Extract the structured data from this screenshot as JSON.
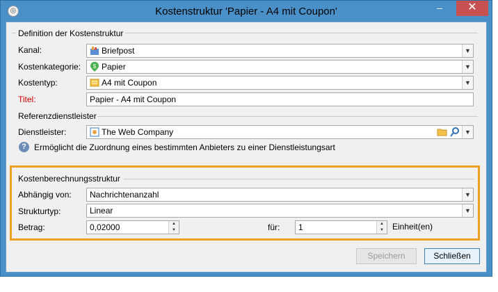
{
  "window": {
    "title": "Kostenstruktur 'Papier - A4 mit Coupon'",
    "controls": {
      "minimize": "–",
      "maximize": "□",
      "close": "✕"
    }
  },
  "definition": {
    "group_title": "Definition der Kostenstruktur",
    "kanal": {
      "label": "Kanal:",
      "value": "Briefpost",
      "icon": "letter-icon"
    },
    "kostenkategorie": {
      "label": "Kostenkategorie:",
      "value": "Papier",
      "icon": "cost-pin-icon"
    },
    "kostentyp": {
      "label": "Kostentyp:",
      "value": "A4 mit Coupon",
      "icon": "document-icon"
    },
    "titel": {
      "label": "Titel:",
      "value": "Papier - A4 mit Coupon"
    }
  },
  "referenz": {
    "group_title": "Referenzdienstleister",
    "dienstleister": {
      "label": "Dienstleister:",
      "value": "The Web Company",
      "icon": "provider-icon"
    },
    "info_text": "Ermöglicht die Zuordnung eines bestimmten Anbieters zu einer Dienstleistungsart"
  },
  "berechnung": {
    "group_title": "Kostenberechnungsstruktur",
    "abhaengig": {
      "label": "Abhängig von:",
      "value": "Nachrichtenanzahl"
    },
    "strukturtyp": {
      "label": "Strukturtyp:",
      "value": "Linear"
    },
    "betrag": {
      "label": "Betrag:",
      "value": "0,02000"
    },
    "fuer": {
      "label": "für:",
      "value": "1",
      "unit": "Einheit(en)"
    }
  },
  "buttons": {
    "save": "Speichern",
    "close": "Schließen"
  },
  "colors": {
    "highlight": "#f0a020",
    "required_label": "#d00000",
    "titlebar": "#4a90c8",
    "close_button": "#c75050"
  }
}
